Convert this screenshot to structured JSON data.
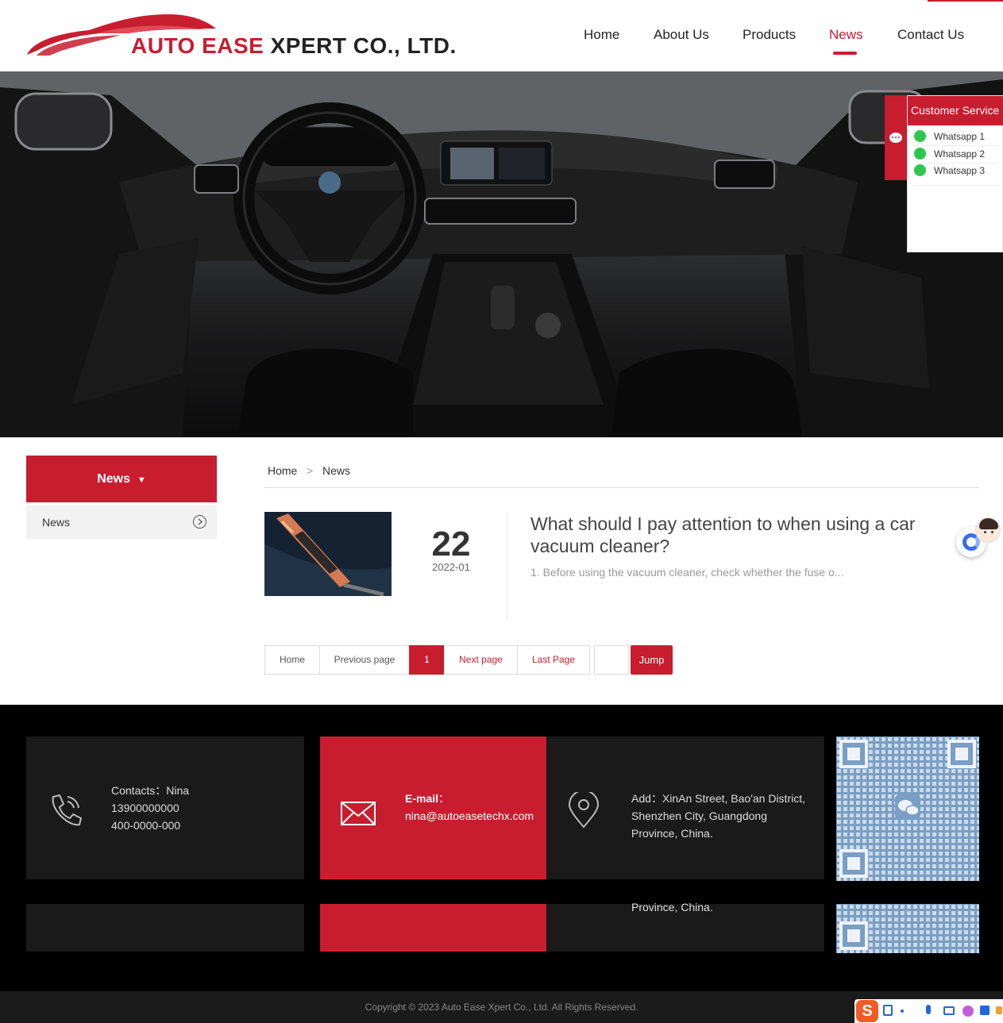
{
  "header": {
    "logo_text_red": "AUTO EASE ",
    "logo_text_dark": "XPERT CO., LTD.",
    "nav": [
      {
        "label": "Home",
        "active": false
      },
      {
        "label": "About Us",
        "active": false
      },
      {
        "label": "Products",
        "active": false
      },
      {
        "label": "News",
        "active": true
      },
      {
        "label": "Contact Us",
        "active": false
      }
    ]
  },
  "customer_service": {
    "title": "Customer Service",
    "items": [
      "Whatsapp 1",
      "Whatsapp 2",
      "Whatsapp 3"
    ]
  },
  "sidebar": {
    "heading": "News",
    "heading_caret": "▼",
    "items": [
      {
        "label": "News"
      }
    ]
  },
  "breadcrumb": {
    "home": "Home",
    "separator": ">",
    "current": "News"
  },
  "news": [
    {
      "day": "22",
      "year_month": "2022-01",
      "title": "What should I pay attention to when using a car vacuum cleaner?",
      "summary": "1. Before using the vacuum cleaner, check whether the fuse o..."
    }
  ],
  "pagination": {
    "home": "Home",
    "previous": "Previous page",
    "current": "1",
    "next": "Next page",
    "last": "Last Page",
    "jump": "Jump"
  },
  "footer": {
    "contacts": {
      "label": "Contacts：Nina",
      "phone1": "13900000000",
      "phone2": "400-0000-000"
    },
    "email": {
      "label": "E-mail",
      "colon": "：",
      "value": "nina@autoeasetechx.com"
    },
    "address": {
      "text": "Add：XinAn Street, Bao'an District, Shenzhen City, Guangdong Province, China.",
      "duplicate_line": "Province, China."
    },
    "copyright": "Copyright © 2023 Auto Ease Xpert Co., Ltd. All Rights Reserved."
  },
  "colors": {
    "brand_red": "#c81d2f",
    "footer_bg": "#000000",
    "footer_box": "#1a1a1a"
  },
  "icons": [
    "phone-icon",
    "mail-icon",
    "location-icon",
    "wechat-qr",
    "chat-icon",
    "whatsapp-icon",
    "chevron-right-circle-icon"
  ]
}
